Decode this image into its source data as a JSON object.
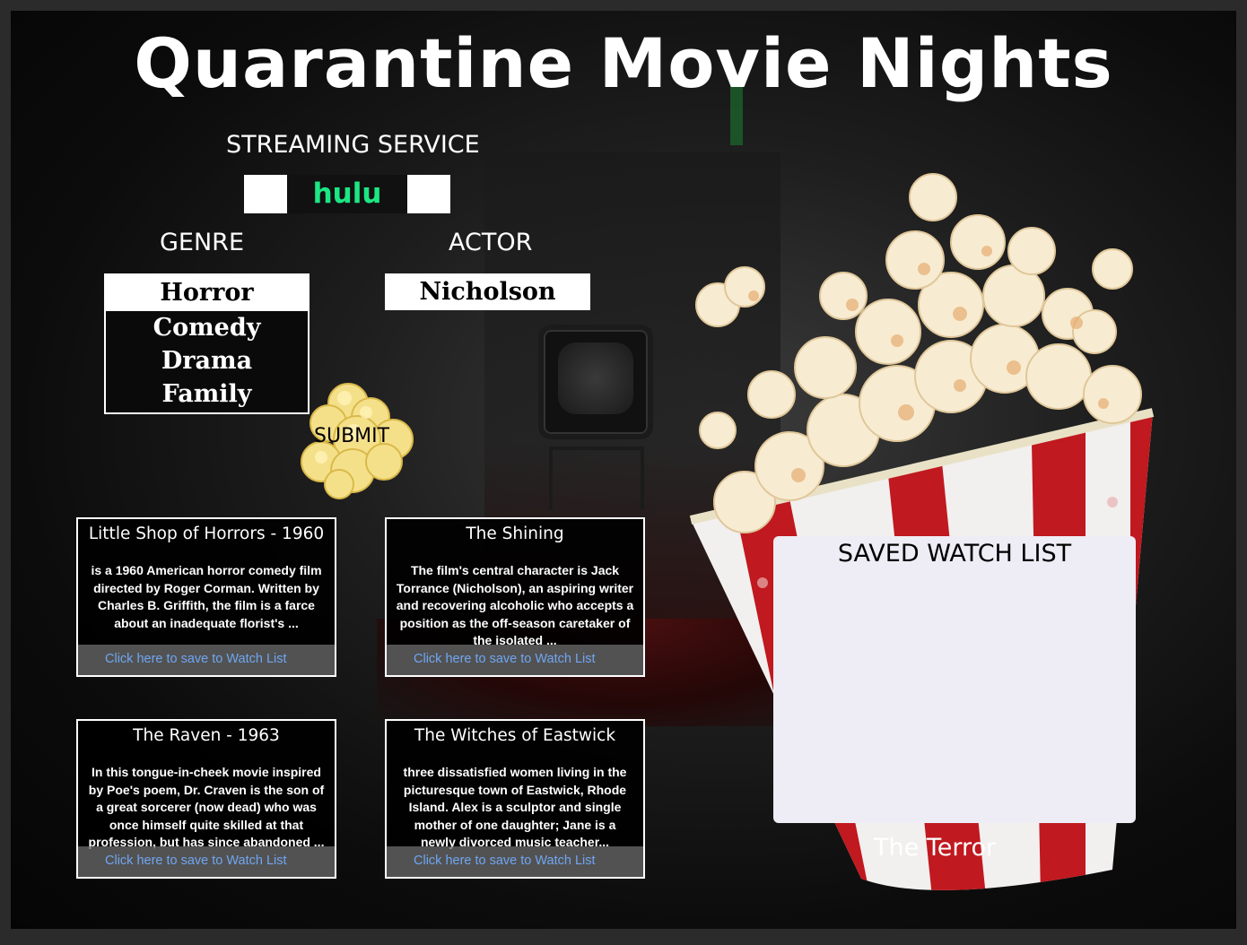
{
  "app": {
    "title": "Quarantine Movie Nights"
  },
  "streaming": {
    "heading": "STREAMING SERVICE",
    "selected": "hulu",
    "brand_color": "#1ce783"
  },
  "genre": {
    "heading": "GENRE",
    "selected": "Horror",
    "options": [
      "Comedy",
      "Drama",
      "Family"
    ]
  },
  "actor": {
    "heading": "ACTOR",
    "value": "Nicholson"
  },
  "submit": {
    "label": "SUBMIT"
  },
  "results": [
    {
      "title": "Little Shop of Horrors - 1960",
      "description": "is a 1960 American horror comedy film directed by Roger Corman. Written by Charles B. Griffith, the film is a farce about an inadequate florist's ...",
      "save_label": "Click here to save to Watch List"
    },
    {
      "title": "The Shining",
      "description": "The film's central character is Jack Torrance (Nicholson), an aspiring writer and recovering alcoholic who accepts a position as the off-season caretaker of the isolated ...",
      "save_label": "Click here to save to Watch List"
    },
    {
      "title": "The Raven - 1963",
      "description": "In this tongue-in-cheek movie inspired by Poe's poem, Dr. Craven is the son of a great sorcerer (now dead) who was once himself quite skilled at that profession, but has since abandoned ...",
      "save_label": "Click here to save to Watch List"
    },
    {
      "title": "The Witches of Eastwick",
      "description": "three dissatisfied women living in the picturesque town of Eastwick, Rhode Island. Alex is a sculptor and single mother of one daughter; Jane is a newly divorced music teacher...",
      "save_label": "Click here to save to Watch List"
    }
  ],
  "watch_list": {
    "heading": "SAVED WATCH LIST",
    "items": [
      "The Terror"
    ]
  },
  "colors": {
    "bucket_red": "#c0191f",
    "link_blue": "#6fa6f2",
    "panel_bg": "#eeecf4"
  }
}
